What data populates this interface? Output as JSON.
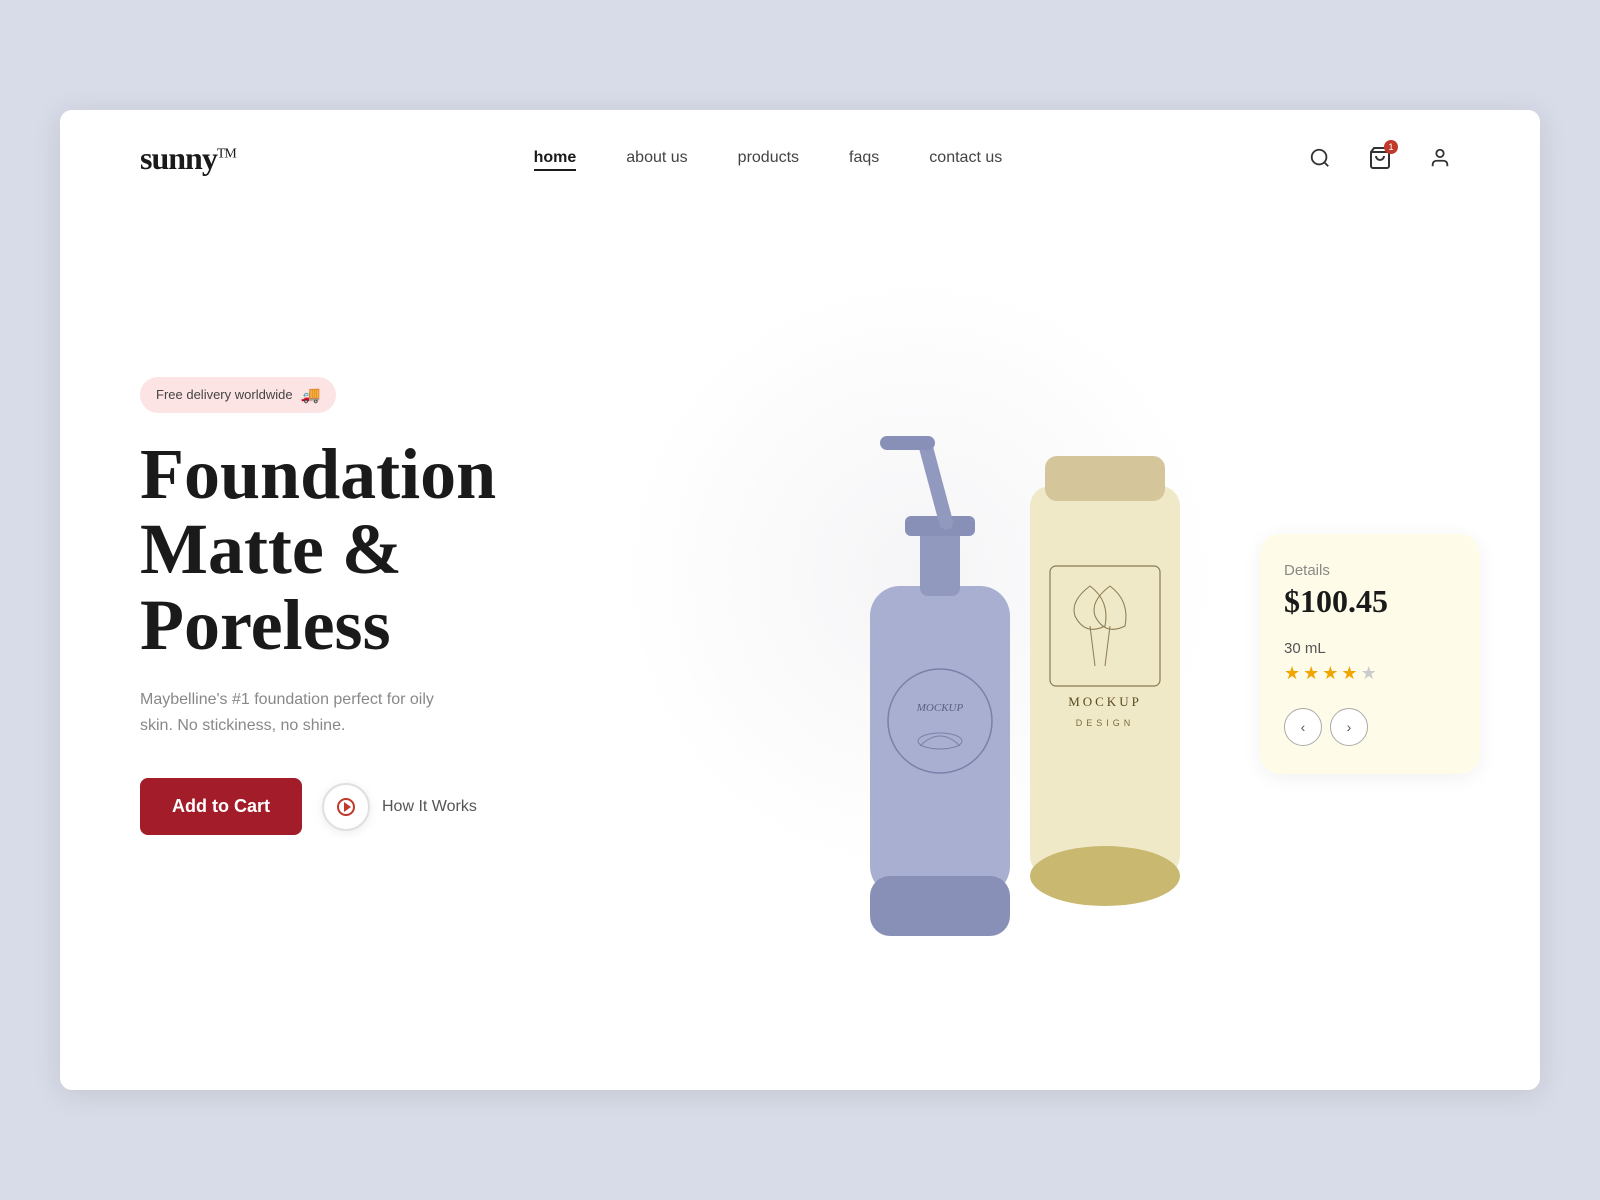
{
  "logo": {
    "text": "sunny",
    "tm": "TM"
  },
  "nav": {
    "items": [
      {
        "label": "home",
        "active": true
      },
      {
        "label": "about us",
        "active": false
      },
      {
        "label": "products",
        "active": false
      },
      {
        "label": "faqs",
        "active": false
      },
      {
        "label": "contact us",
        "active": false
      }
    ]
  },
  "header_icons": {
    "search": "🔍",
    "cart_badge": "1",
    "user": "👤"
  },
  "hero": {
    "badge_text": "Free delivery worldwide",
    "badge_emoji": "🚚",
    "title_line1": "Foundation",
    "title_line2": "Matte &",
    "title_line3": "Poreless",
    "description": "Maybelline's #1 foundation perfect for oily skin. No stickiness, no shine.",
    "add_to_cart": "Add to Cart",
    "how_it_works": "How It Works"
  },
  "product_card": {
    "details_label": "Details",
    "price": "$100.45",
    "volume": "30 mL",
    "stars_filled": 4,
    "stars_half": 1,
    "prev_arrow": "‹",
    "next_arrow": "›"
  }
}
